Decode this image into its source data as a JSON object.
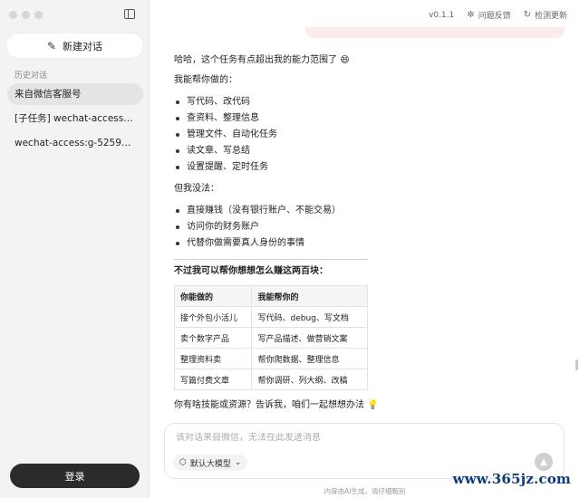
{
  "sidebar": {
    "new_chat_label": "新建对话",
    "history_title": "历史对话",
    "items": [
      {
        "label": "来自微信客服号"
      },
      {
        "label": "[子任务] wechat-access:g-..."
      },
      {
        "label": "wechat-access:g-5259143..."
      }
    ],
    "login_label": "登录"
  },
  "topbar": {
    "version": "v0.1.1",
    "feedback_label": "问题反馈",
    "update_label": "检测更新"
  },
  "message": {
    "intro": "哈哈，这个任务有点超出我的能力范围了",
    "intro_emoji": "😄",
    "can_title": "我能帮你做的：",
    "can_items": [
      "写代码、改代码",
      "查资料、整理信息",
      "管理文件、自动化任务",
      "读文章、写总结",
      "设置提醒、定时任务"
    ],
    "cannot_title": "但我没法：",
    "cannot_items": [
      "直接赚钱（没有银行账户、不能交易）",
      "访问你的财务账户",
      "代替你做需要真人身份的事情"
    ],
    "section_title": "不过我可以帮你想想怎么赚这两百块：",
    "table": {
      "headers": [
        "你能做的",
        "我能帮你的"
      ],
      "rows": [
        [
          "接个外包小活儿",
          "写代码、debug、写文档"
        ],
        [
          "卖个数字产品",
          "写产品描述、做营销文案"
        ],
        [
          "整理资料卖",
          "帮你爬数据、整理信息"
        ],
        [
          "写篇付费文章",
          "帮你调研、列大纲、改稿"
        ]
      ]
    },
    "closing": "你有啥技能或资源？告诉我，咱们一起想想办法",
    "closing_emoji": "💡"
  },
  "input": {
    "placeholder": "该对话来自微信，无法在此发送消息",
    "model_label": "默认大模型"
  },
  "footer": {
    "disclaimer": "内容由AI生成，请仔细甄别"
  },
  "watermark": "www.365jz.com"
}
